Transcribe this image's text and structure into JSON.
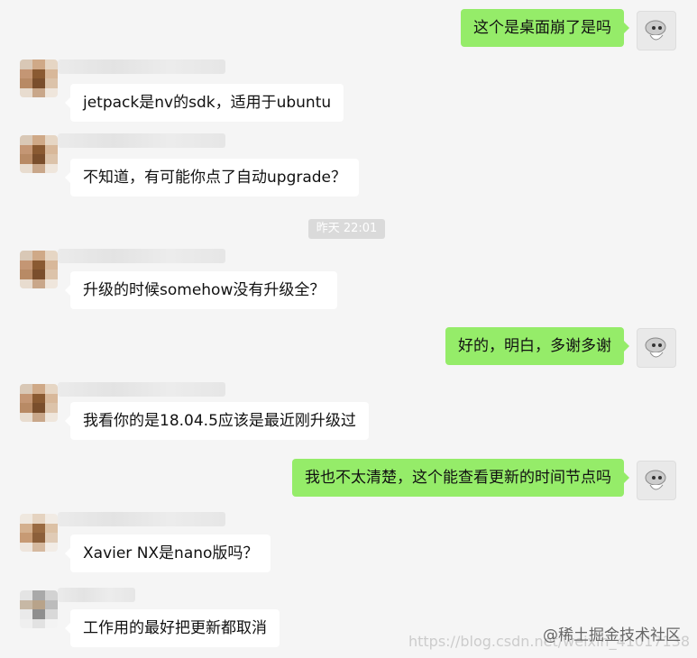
{
  "chat": {
    "timestamp": "昨天 22:01",
    "messages": [
      {
        "sender": "me",
        "text": "这个是桌面崩了是吗"
      },
      {
        "sender": "other",
        "text": "jetpack是nv的sdk，适用于ubuntu"
      },
      {
        "sender": "other",
        "text": "不知道，有可能你点了自动upgrade？"
      },
      {
        "sender": "other",
        "text": "升级的时候somehow没有升级全？"
      },
      {
        "sender": "me",
        "text": "好的，明白，多谢多谢"
      },
      {
        "sender": "other",
        "text": "我看你的是18.04.5应该是最近刚升级过"
      },
      {
        "sender": "me",
        "text": "我也不太清楚，这个能查看更新的时间节点吗"
      },
      {
        "sender": "other",
        "text": "Xavier NX是nano版吗？"
      },
      {
        "sender": "other",
        "text": "工作用的最好把更新都取消"
      }
    ]
  },
  "watermark": {
    "brand": "@稀土掘金技术社区",
    "url": "https://blog.csdn.net/weixin_41017138"
  }
}
